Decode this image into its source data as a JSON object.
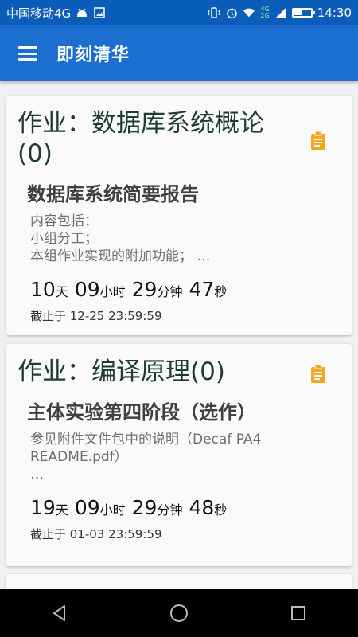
{
  "status_bar": {
    "carrier": "中国移动4G",
    "network_tags": [
      "4G",
      "2G"
    ],
    "time": "14:30"
  },
  "app_bar": {
    "title": "即刻清华",
    "menu_icon": "hamburger-menu-icon"
  },
  "cards": [
    {
      "title": "作业：数据库系统概论(0)",
      "icon": "clipboard-icon",
      "item_title": "数据库系统简要报告",
      "description": "内容包括：\n小组分工；\n本组作业实现的附加功能； …",
      "countdown": {
        "days": "10",
        "day_unit": "天",
        "hours": "09",
        "hour_unit": "小时",
        "minutes": "29",
        "minute_unit": "分钟",
        "seconds": "47",
        "second_unit": "秒"
      },
      "deadline": "截止于 12-25 23:59:59"
    },
    {
      "title": "作业：编译原理(0)",
      "icon": "clipboard-icon",
      "item_title": "主体实验第四阶段（选作）",
      "description": "参见附件文件包中的说明（Decaf PA4 README.pdf）\n…",
      "countdown": {
        "days": "19",
        "day_unit": "天",
        "hours": "09",
        "hour_unit": "小时",
        "minutes": "29",
        "minute_unit": "分钟",
        "seconds": "48",
        "second_unit": "秒"
      },
      "deadline": "截止于 01-03 23:59:59"
    }
  ],
  "colors": {
    "status_bar": "#0a5db8",
    "app_bar": "#1c6fd1",
    "icon_accent": "#f5a623"
  }
}
